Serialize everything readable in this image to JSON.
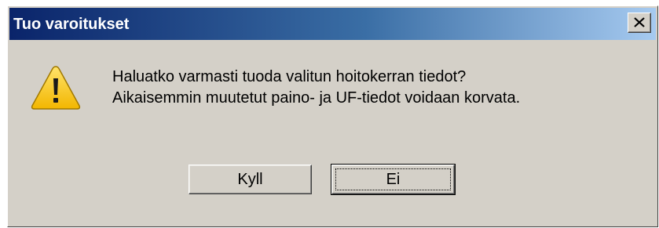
{
  "window": {
    "title": "Tuo varoitukset",
    "close_symbol": "✕"
  },
  "message": {
    "line1": "Haluatko varmasti tuoda valitun hoitokerran tiedot?",
    "line2": "Aikaisemmin muutetut paino- ja UF-tiedot voidaan korvata."
  },
  "buttons": {
    "yes_label": "Kyll",
    "no_label": "Ei"
  },
  "icons": {
    "warning": "warning-icon",
    "close": "close-icon"
  },
  "colors": {
    "title_gradient_start": "#0a246a",
    "title_gradient_end": "#a6caf0",
    "dialog_background": "#d4d0c8",
    "warning_yellow": "#f6c400"
  }
}
